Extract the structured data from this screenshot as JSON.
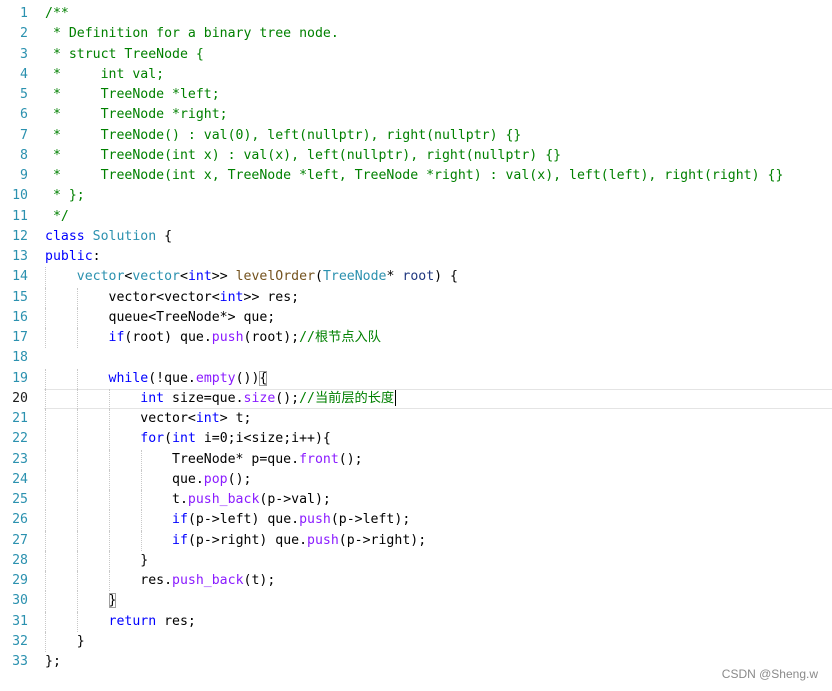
{
  "editor": {
    "lines": [
      {
        "n": "1",
        "indent": 0,
        "tokens": [
          [
            "cm",
            "/**"
          ]
        ]
      },
      {
        "n": "2",
        "indent": 0,
        "tokens": [
          [
            "cm",
            " * Definition for a binary tree node."
          ]
        ]
      },
      {
        "n": "3",
        "indent": 0,
        "tokens": [
          [
            "cm",
            " * struct TreeNode {"
          ]
        ]
      },
      {
        "n": "4",
        "indent": 0,
        "tokens": [
          [
            "cm",
            " *     int val;"
          ]
        ]
      },
      {
        "n": "5",
        "indent": 0,
        "tokens": [
          [
            "cm",
            " *     TreeNode *left;"
          ]
        ]
      },
      {
        "n": "6",
        "indent": 0,
        "tokens": [
          [
            "cm",
            " *     TreeNode *right;"
          ]
        ]
      },
      {
        "n": "7",
        "indent": 0,
        "tokens": [
          [
            "cm",
            " *     TreeNode() : val(0), left(nullptr), right(nullptr) {}"
          ]
        ]
      },
      {
        "n": "8",
        "indent": 0,
        "tokens": [
          [
            "cm",
            " *     TreeNode(int x) : val(x), left(nullptr), right(nullptr) {}"
          ]
        ]
      },
      {
        "n": "9",
        "indent": 0,
        "tokens": [
          [
            "cm",
            " *     TreeNode(int x, TreeNode *left, TreeNode *right) : val(x), left(left), right(right) {}"
          ]
        ]
      },
      {
        "n": "10",
        "indent": 0,
        "tokens": [
          [
            "cm",
            " * };"
          ]
        ]
      },
      {
        "n": "11",
        "indent": 0,
        "tokens": [
          [
            "cm",
            " */"
          ]
        ]
      },
      {
        "n": "12",
        "indent": 0,
        "tokens": [
          [
            "kw",
            "class"
          ],
          [
            "pl",
            " "
          ],
          [
            "ty",
            "Solution"
          ],
          [
            "pl",
            " {"
          ]
        ]
      },
      {
        "n": "13",
        "indent": 0,
        "tokens": [
          [
            "kw",
            "public"
          ],
          [
            "pl",
            ":"
          ]
        ]
      },
      {
        "n": "14",
        "indent": 1,
        "tokens": [
          [
            "pl",
            "    "
          ],
          [
            "ty",
            "vector"
          ],
          [
            "pl",
            "<"
          ],
          [
            "ty",
            "vector"
          ],
          [
            "pl",
            "<"
          ],
          [
            "kw",
            "int"
          ],
          [
            "pl",
            ">> "
          ],
          [
            "fn",
            "levelOrder"
          ],
          [
            "pl",
            "("
          ],
          [
            "ty",
            "TreeNode"
          ],
          [
            "pl",
            "* "
          ],
          [
            "id",
            "root"
          ],
          [
            "pl",
            ") {"
          ]
        ]
      },
      {
        "n": "15",
        "indent": 2,
        "tokens": [
          [
            "pl",
            "        vector<vector<"
          ],
          [
            "kw",
            "int"
          ],
          [
            "pl",
            ">> res;"
          ]
        ]
      },
      {
        "n": "16",
        "indent": 2,
        "tokens": [
          [
            "pl",
            "        queue<TreeNode*> que;"
          ]
        ]
      },
      {
        "n": "17",
        "indent": 2,
        "tokens": [
          [
            "pl",
            "        "
          ],
          [
            "kw",
            "if"
          ],
          [
            "pl",
            "(root) que."
          ],
          [
            "mb",
            "push"
          ],
          [
            "pl",
            "(root);"
          ],
          [
            "cm",
            "//根节点入队"
          ]
        ]
      },
      {
        "n": "18",
        "indent": 2,
        "tokens": []
      },
      {
        "n": "19",
        "indent": 2,
        "tokens": [
          [
            "pl",
            "        "
          ],
          [
            "kw",
            "while"
          ],
          [
            "pl",
            "(!que."
          ],
          [
            "mb",
            "empty"
          ],
          [
            "pl",
            "())"
          ],
          [
            "box",
            "{"
          ]
        ]
      },
      {
        "n": "20",
        "indent": 3,
        "current": true,
        "tokens": [
          [
            "pl",
            "            "
          ],
          [
            "kw",
            "int"
          ],
          [
            "pl",
            " size=que."
          ],
          [
            "mb",
            "size"
          ],
          [
            "pl",
            "();"
          ],
          [
            "cm",
            "//当前层的长度"
          ],
          [
            "caret",
            ""
          ]
        ]
      },
      {
        "n": "21",
        "indent": 3,
        "tokens": [
          [
            "pl",
            "            vector<"
          ],
          [
            "kw",
            "int"
          ],
          [
            "pl",
            "> t;"
          ]
        ]
      },
      {
        "n": "22",
        "indent": 3,
        "tokens": [
          [
            "pl",
            "            "
          ],
          [
            "kw",
            "for"
          ],
          [
            "pl",
            "("
          ],
          [
            "kw",
            "int"
          ],
          [
            "pl",
            " i=0;i<size;i++){"
          ]
        ]
      },
      {
        "n": "23",
        "indent": 4,
        "tokens": [
          [
            "pl",
            "                TreeNode* p=que."
          ],
          [
            "mb",
            "front"
          ],
          [
            "pl",
            "();"
          ]
        ]
      },
      {
        "n": "24",
        "indent": 4,
        "tokens": [
          [
            "pl",
            "                que."
          ],
          [
            "mb",
            "pop"
          ],
          [
            "pl",
            "();"
          ]
        ]
      },
      {
        "n": "25",
        "indent": 4,
        "tokens": [
          [
            "pl",
            "                t."
          ],
          [
            "mb",
            "push_back"
          ],
          [
            "pl",
            "(p->val);"
          ]
        ]
      },
      {
        "n": "26",
        "indent": 4,
        "tokens": [
          [
            "pl",
            "                "
          ],
          [
            "kw",
            "if"
          ],
          [
            "pl",
            "(p->left) que."
          ],
          [
            "mb",
            "push"
          ],
          [
            "pl",
            "(p->left);"
          ]
        ]
      },
      {
        "n": "27",
        "indent": 4,
        "tokens": [
          [
            "pl",
            "                "
          ],
          [
            "kw",
            "if"
          ],
          [
            "pl",
            "(p->right) que."
          ],
          [
            "mb",
            "push"
          ],
          [
            "pl",
            "(p->right);"
          ]
        ]
      },
      {
        "n": "28",
        "indent": 3,
        "tokens": [
          [
            "pl",
            "            }"
          ]
        ]
      },
      {
        "n": "29",
        "indent": 3,
        "tokens": [
          [
            "pl",
            "            res."
          ],
          [
            "mb",
            "push_back"
          ],
          [
            "pl",
            "(t);"
          ]
        ]
      },
      {
        "n": "30",
        "indent": 2,
        "tokens": [
          [
            "pl",
            "        "
          ],
          [
            "box",
            "}"
          ]
        ]
      },
      {
        "n": "31",
        "indent": 2,
        "tokens": [
          [
            "pl",
            "        "
          ],
          [
            "kw",
            "return"
          ],
          [
            "pl",
            " res;"
          ]
        ]
      },
      {
        "n": "32",
        "indent": 1,
        "tokens": [
          [
            "pl",
            "    }"
          ]
        ]
      },
      {
        "n": "33",
        "indent": 0,
        "tokens": [
          [
            "pl",
            "};"
          ]
        ]
      }
    ]
  },
  "watermark": "CSDN @Sheng.w",
  "colors": {
    "line_number": "#2b91af",
    "comment": "#008000",
    "keyword": "#0000ff",
    "type": "#2b91af",
    "member": "#8a1bff"
  }
}
